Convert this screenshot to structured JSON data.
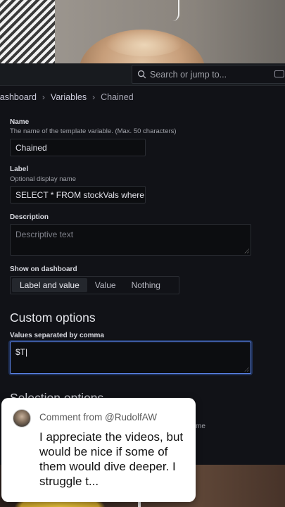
{
  "topbar": {
    "search_placeholder": "Search or jump to..."
  },
  "breadcrumb": {
    "items": [
      "lashboard",
      "Variables",
      "Chained"
    ]
  },
  "form": {
    "name": {
      "label": "Name",
      "hint": "The name of the template variable. (Max. 50 characters)",
      "value": "Chained"
    },
    "label": {
      "label": "Label",
      "hint": "Optional display name",
      "value": "SELECT * FROM stockVals where"
    },
    "description": {
      "label": "Description",
      "placeholder": "Descriptive text"
    },
    "show_on_dashboard": {
      "label": "Show on dashboard",
      "options": [
        "Label and value",
        "Value",
        "Nothing"
      ],
      "selected": "Label and value"
    },
    "custom_options": {
      "heading": "Custom options",
      "label": "Values separated by comma",
      "value": "$T|"
    },
    "selection_heading": "Selection options",
    "faded_text": "me"
  },
  "comment": {
    "from": "Comment from @RudolfAW",
    "body": "I appreciate the videos, but would be nice if some of them would dive deeper. I struggle t..."
  },
  "colors": {
    "accent": "#5b83e8",
    "background": "#111217",
    "panel": "#181b1f"
  }
}
